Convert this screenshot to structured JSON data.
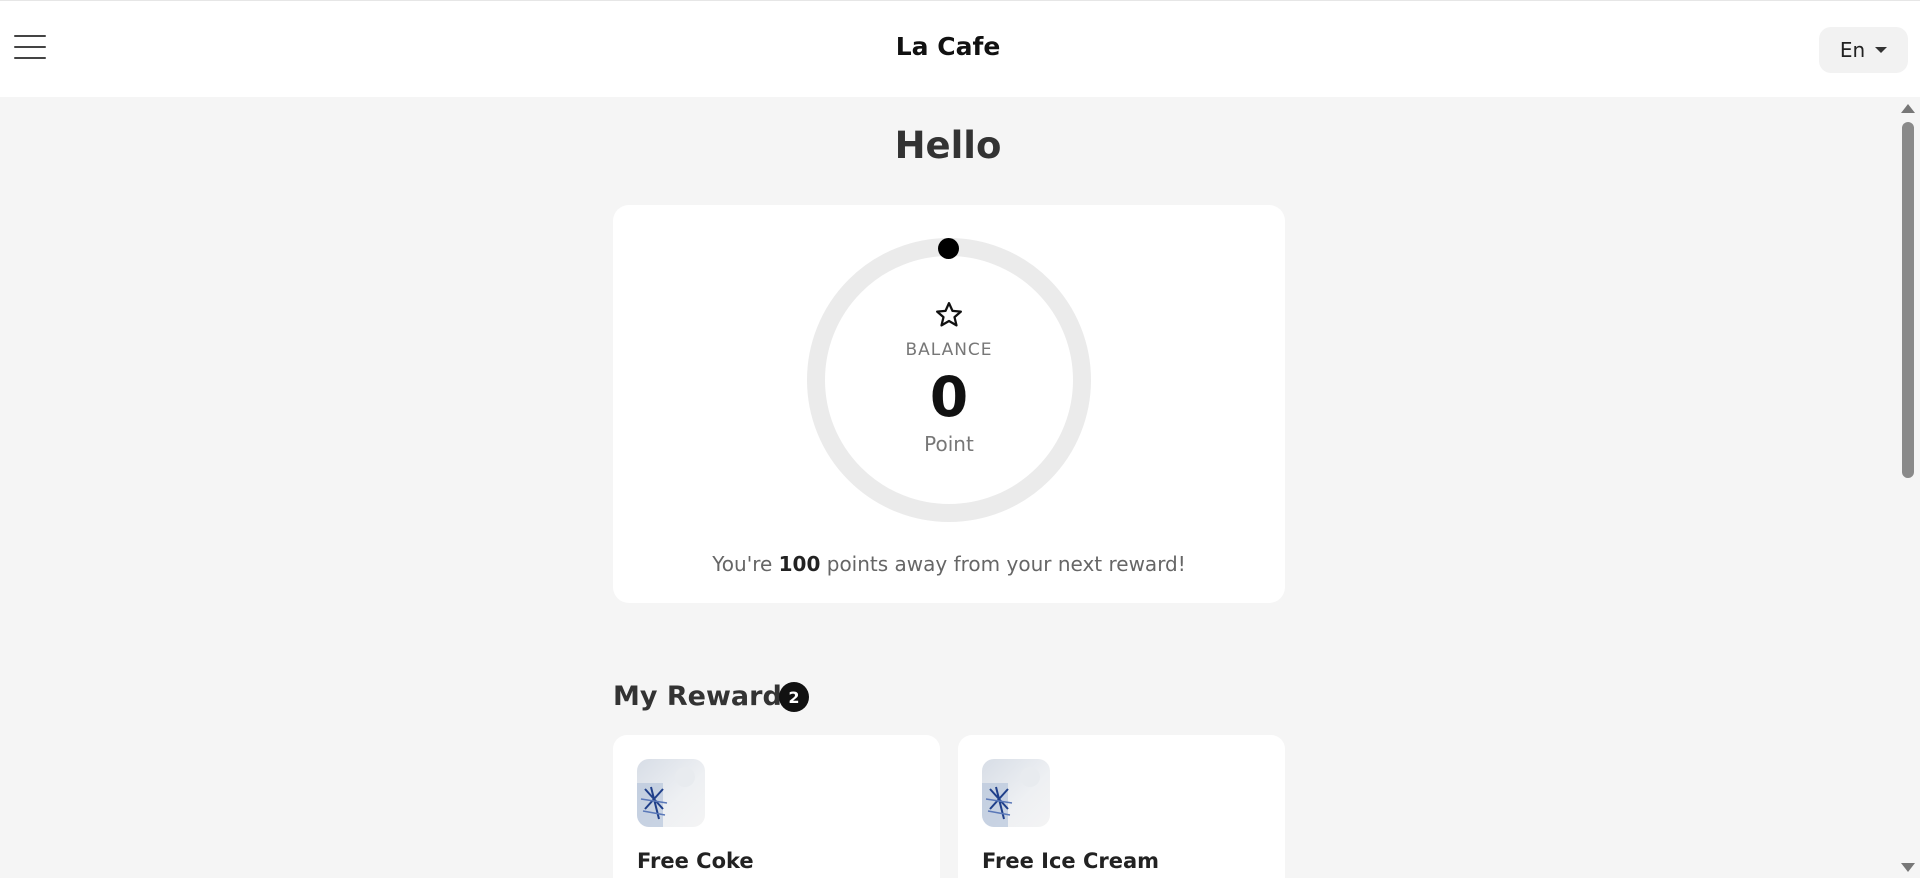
{
  "header": {
    "brand": "La Cafe",
    "language": "En",
    "menu_icon": "hamburger-menu-icon"
  },
  "greeting": "Hello",
  "balance": {
    "icon": "star-icon",
    "label": "BALANCE",
    "value": "0",
    "unit": "Point",
    "progress": 0,
    "message_prefix": "You're ",
    "points_away": "100",
    "message_suffix": " points away from your next reward!"
  },
  "rewards": {
    "title": "My Rewards",
    "count": "2",
    "items": [
      {
        "name": "Free Coke"
      },
      {
        "name": "Free Ice Cream"
      }
    ]
  },
  "colors": {
    "accent": "#000000",
    "ring": "#ebebeb",
    "background": "#f5f5f5"
  }
}
